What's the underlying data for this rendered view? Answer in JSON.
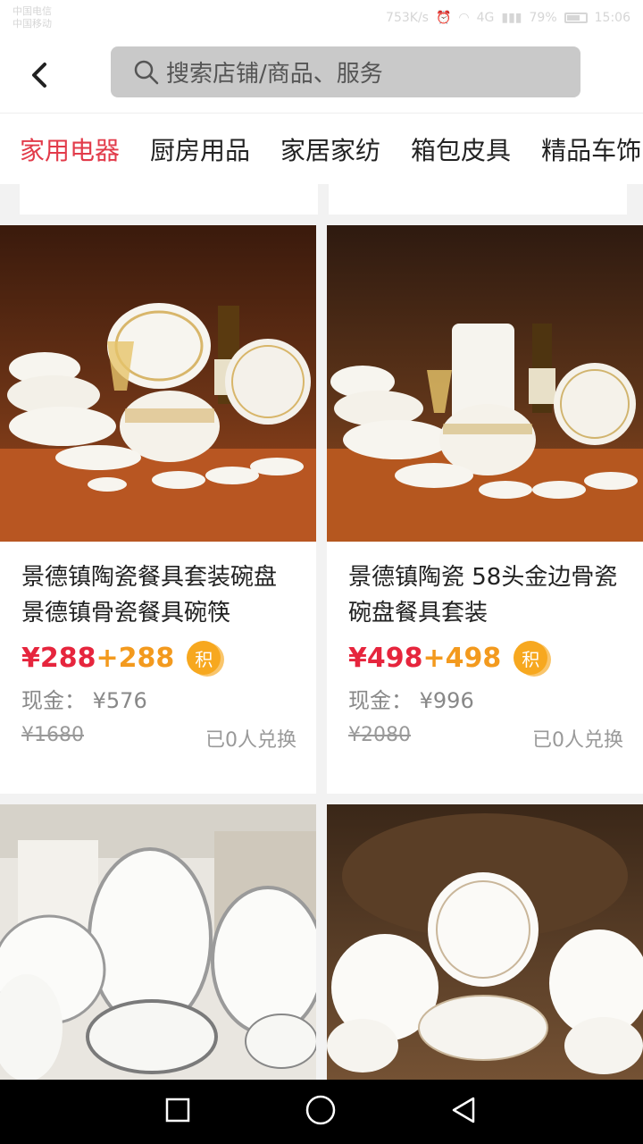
{
  "status": {
    "carrier_line1": "中国电信",
    "carrier_line2": "中国移动",
    "speed": "753K/s",
    "signal_label": "4G",
    "battery": "79%",
    "time": "15:06"
  },
  "header": {
    "search_placeholder": "搜索店铺/商品、服务"
  },
  "tabs": [
    "家用电器",
    "厨房用品",
    "家居家纺",
    "箱包皮具",
    "精品车饰"
  ],
  "products": [
    {
      "title": "景德镇陶瓷餐具套装碗盘景德镇骨瓷餐具碗筷",
      "price": "¥288",
      "points": "+288",
      "points_badge": "积",
      "cash_label": "现金：",
      "cash": "¥576",
      "original_price": "¥1680",
      "redeemed": "已0人兑换"
    },
    {
      "title": "景德镇陶瓷 58头金边骨瓷 碗盘餐具套装",
      "price": "¥498",
      "points": "+498",
      "points_badge": "积",
      "cash_label": "现金：",
      "cash": "¥996",
      "original_price": "¥2080",
      "redeemed": "已0人兑换"
    }
  ],
  "colors": {
    "accent_red": "#e23b4a",
    "price_red": "#e6253d",
    "points_orange": "#f39a1e"
  }
}
